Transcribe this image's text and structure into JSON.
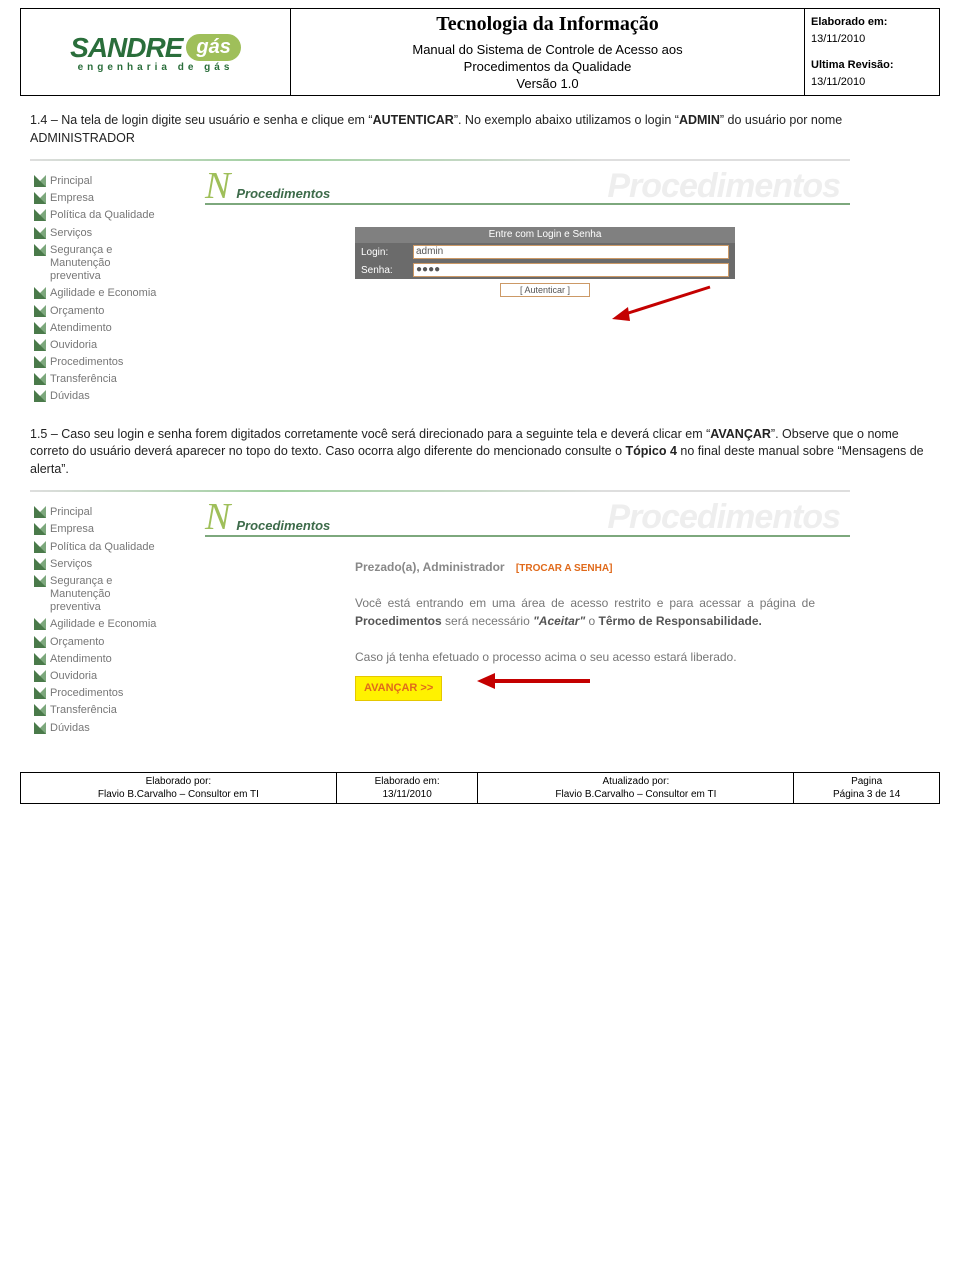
{
  "header": {
    "logo_name": "SANDRE",
    "logo_cap": "gás",
    "logo_sub": "engenharia de gás",
    "title": "Tecnologia da Informação",
    "subtitle1": "Manual do Sistema de Controle de Acesso aos",
    "subtitle2": "Procedimentos da Qualidade",
    "version": "Versão 1.0",
    "elab_lbl": "Elaborado em:",
    "elab_date": "13/11/2010",
    "rev_lbl": "Ultima Revisão:",
    "rev_date": "13/11/2010"
  },
  "para1": {
    "prefix": "1.4 – Na tela de login digite seu usuário e senha e clique em “",
    "bold1": "AUTENTICAR",
    "mid": "”. No exemplo abaixo utilizamos o login “",
    "bold2": "ADMIN",
    "after": "” do usuário por nome ADMINISTRADOR"
  },
  "menu_items": [
    "Principal",
    "Empresa",
    "Política da Qualidade",
    "Serviços",
    "Segurança e\nManutenção\npreventiva",
    "Agilidade e Economia",
    "Orçamento",
    "Atendimento",
    "Ouvidoria",
    "Procedimentos",
    "Transferência",
    "Dúvidas"
  ],
  "proc_heading": "Procedimentos",
  "login": {
    "bar": "Entre com Login e Senha",
    "login_lbl": "Login:",
    "login_val": "admin",
    "senha_lbl": "Senha:",
    "senha_val": "●●●●",
    "button": "[ Autenticar ]"
  },
  "para2": {
    "prefix": "1.5 – Caso seu login e senha forem digitados corretamente você será direcionado para a seguinte tela e deverá clicar em “",
    "bold1": "AVANÇAR",
    "mid": "”. Observe que o nome correto do usuário deverá aparecer no topo do texto. Caso ocorra algo diferente do mencionado consulte o ",
    "bold2": "Tópico 4",
    "after": " no final deste manual sobre “Mensagens de alerta”."
  },
  "welcome": {
    "greet": "Prezado(a), Administrador",
    "trocar": "[TROCAR A SENHA]",
    "line1a": "Você está entrando em uma área de acesso restrito e para acessar a página de ",
    "proc": "Procedimentos",
    "line1b": " será necessário ",
    "aceitar": "\"Aceitar\"",
    "line1c": " o ",
    "termo": "Têrmo de Responsabilidade.",
    "line2": "Caso já tenha efetuado o processo acima o seu acesso estará liberado.",
    "btn": "AVANÇAR >>"
  },
  "footer": {
    "c1_lbl": "Elaborado por:",
    "c1_val": "Flavio B.Carvalho – Consultor em TI",
    "c2_lbl": "Elaborado em:",
    "c2_val": "13/11/2010",
    "c3_lbl": "Atualizado por:",
    "c3_val": "Flavio B.Carvalho – Consultor em TI",
    "c4_lbl": "Pagina",
    "c4_val": "Página 3 de 14"
  }
}
